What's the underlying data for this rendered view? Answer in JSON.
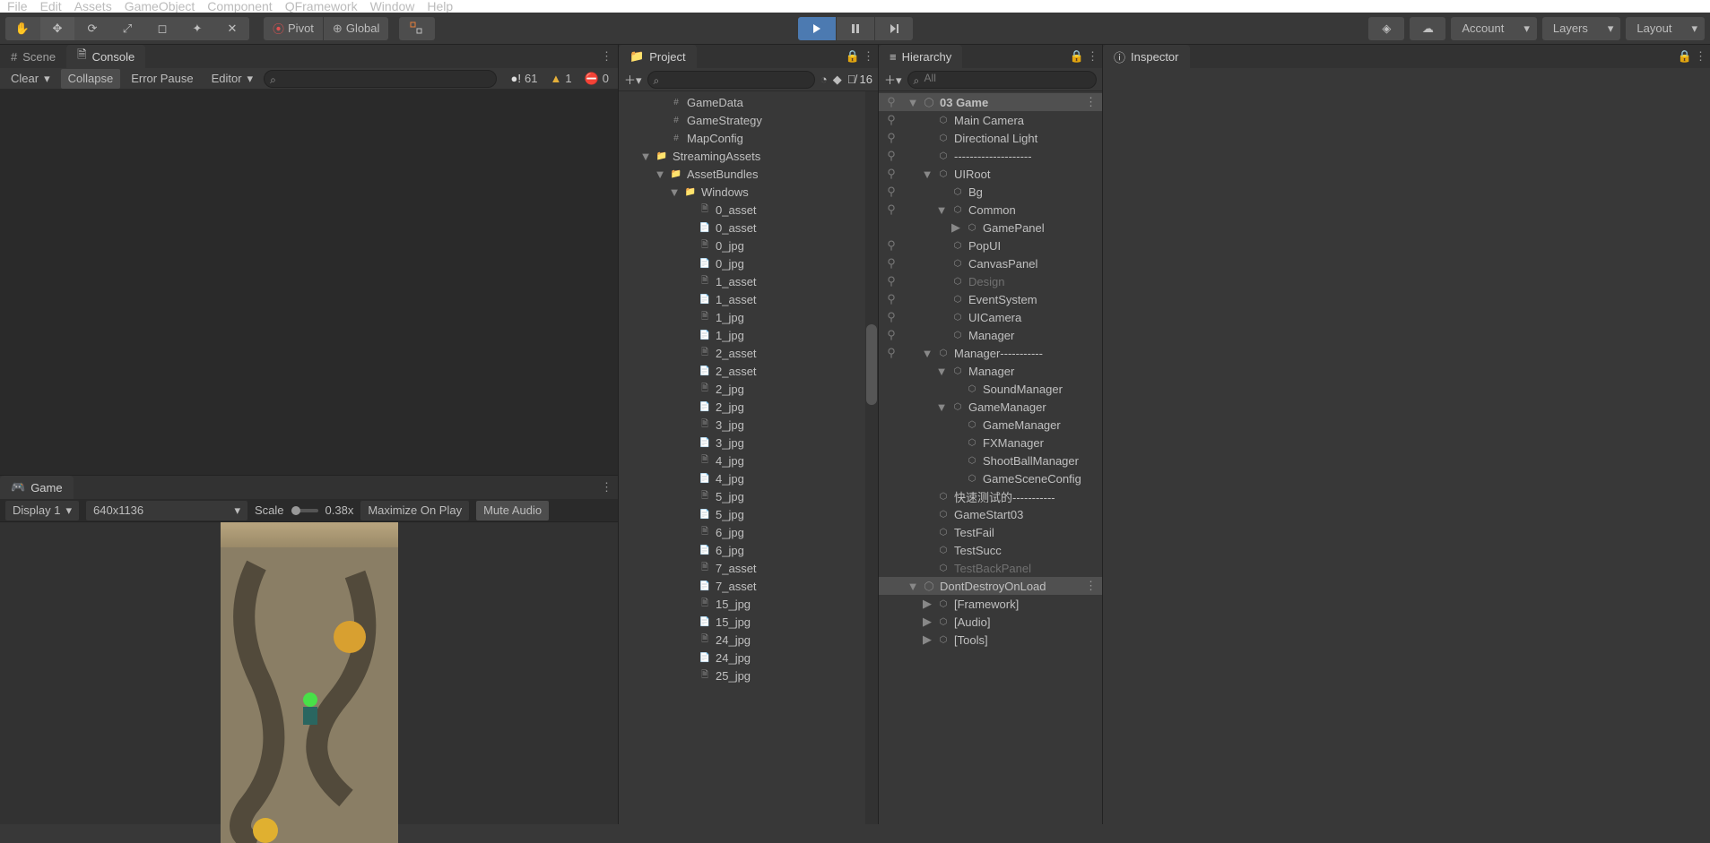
{
  "menu": [
    "File",
    "Edit",
    "Assets",
    "GameObject",
    "Component",
    "QFramework",
    "Window",
    "Help"
  ],
  "pivot": "Pivot",
  "global": "Global",
  "topbar": {
    "account": "Account",
    "layers": "Layers",
    "layout": "Layout"
  },
  "scene_tab": "Scene",
  "console_tab": "Console",
  "console": {
    "clear": "Clear",
    "collapse": "Collapse",
    "errorPause": "Error Pause",
    "editor": "Editor",
    "info": "61",
    "warn": "1",
    "error": "0"
  },
  "game_tab": "Game",
  "game_toolbar": {
    "display": "Display 1",
    "resolution": "640x1136",
    "scale_label": "Scale",
    "scale_value": "0.38x",
    "maximize": "Maximize On Play",
    "mute": "Mute Audio"
  },
  "project_tab": "Project",
  "hierarchy_tab": "Hierarchy",
  "inspector_tab": "Inspector",
  "search_placeholder": "",
  "hierarchy_search_placeholder": "All",
  "hidden_count": "16",
  "project_items": [
    {
      "indent": 2,
      "icon": "script",
      "label": "GameData"
    },
    {
      "indent": 2,
      "icon": "script",
      "label": "GameStrategy"
    },
    {
      "indent": 2,
      "icon": "script",
      "label": "MapConfig"
    },
    {
      "indent": 1,
      "icon": "folder",
      "label": "StreamingAssets",
      "fold": "▼"
    },
    {
      "indent": 2,
      "icon": "folder",
      "label": "AssetBundles",
      "fold": "▼"
    },
    {
      "indent": 3,
      "icon": "folder",
      "label": "Windows",
      "fold": "▼"
    },
    {
      "indent": 4,
      "icon": "file",
      "label": "0_asset"
    },
    {
      "indent": 4,
      "icon": "doc",
      "label": "0_asset"
    },
    {
      "indent": 4,
      "icon": "file",
      "label": "0_jpg"
    },
    {
      "indent": 4,
      "icon": "doc",
      "label": "0_jpg"
    },
    {
      "indent": 4,
      "icon": "file",
      "label": "1_asset"
    },
    {
      "indent": 4,
      "icon": "doc",
      "label": "1_asset"
    },
    {
      "indent": 4,
      "icon": "file",
      "label": "1_jpg"
    },
    {
      "indent": 4,
      "icon": "doc",
      "label": "1_jpg"
    },
    {
      "indent": 4,
      "icon": "file",
      "label": "2_asset"
    },
    {
      "indent": 4,
      "icon": "doc",
      "label": "2_asset"
    },
    {
      "indent": 4,
      "icon": "file",
      "label": "2_jpg"
    },
    {
      "indent": 4,
      "icon": "doc",
      "label": "2_jpg"
    },
    {
      "indent": 4,
      "icon": "file",
      "label": "3_jpg"
    },
    {
      "indent": 4,
      "icon": "doc",
      "label": "3_jpg"
    },
    {
      "indent": 4,
      "icon": "file",
      "label": "4_jpg"
    },
    {
      "indent": 4,
      "icon": "doc",
      "label": "4_jpg"
    },
    {
      "indent": 4,
      "icon": "file",
      "label": "5_jpg"
    },
    {
      "indent": 4,
      "icon": "doc",
      "label": "5_jpg"
    },
    {
      "indent": 4,
      "icon": "file",
      "label": "6_jpg"
    },
    {
      "indent": 4,
      "icon": "doc",
      "label": "6_jpg"
    },
    {
      "indent": 4,
      "icon": "file",
      "label": "7_asset"
    },
    {
      "indent": 4,
      "icon": "doc",
      "label": "7_asset"
    },
    {
      "indent": 4,
      "icon": "file",
      "label": "15_jpg"
    },
    {
      "indent": 4,
      "icon": "doc",
      "label": "15_jpg"
    },
    {
      "indent": 4,
      "icon": "file",
      "label": "24_jpg"
    },
    {
      "indent": 4,
      "icon": "doc",
      "label": "24_jpg"
    },
    {
      "indent": 4,
      "icon": "file",
      "label": "25_jpg"
    }
  ],
  "hierarchy_items": [
    {
      "indent": 0,
      "icon": "unity",
      "label": "03 Game",
      "fold": "▼",
      "selected": true,
      "bold": true,
      "tog": true,
      "menu": true
    },
    {
      "indent": 1,
      "icon": "box",
      "label": "Main Camera",
      "tog": true
    },
    {
      "indent": 1,
      "icon": "box",
      "label": "Directional Light",
      "tog": true
    },
    {
      "indent": 1,
      "icon": "dimbox",
      "label": "--------------------",
      "tog": true
    },
    {
      "indent": 1,
      "icon": "box",
      "label": "UIRoot",
      "fold": "▼",
      "tog": true
    },
    {
      "indent": 2,
      "icon": "box",
      "label": "Bg",
      "tog": true
    },
    {
      "indent": 2,
      "icon": "box",
      "label": "Common",
      "fold": "▼",
      "tog": true
    },
    {
      "indent": 3,
      "icon": "box",
      "label": "GamePanel",
      "fold": "▶"
    },
    {
      "indent": 2,
      "icon": "box",
      "label": "PopUI",
      "tog": true
    },
    {
      "indent": 2,
      "icon": "box",
      "label": "CanvasPanel",
      "tog": true
    },
    {
      "indent": 2,
      "icon": "dimbox",
      "label": "Design",
      "dim": true,
      "tog": true
    },
    {
      "indent": 2,
      "icon": "box",
      "label": "EventSystem",
      "tog": true
    },
    {
      "indent": 2,
      "icon": "box",
      "label": "UICamera",
      "tog": true
    },
    {
      "indent": 2,
      "icon": "box",
      "label": "Manager",
      "tog": true
    },
    {
      "indent": 1,
      "icon": "box",
      "label": "Manager-----------",
      "fold": "▼",
      "tog": true
    },
    {
      "indent": 2,
      "icon": "box",
      "label": "Manager",
      "fold": "▼"
    },
    {
      "indent": 3,
      "icon": "box",
      "label": "SoundManager"
    },
    {
      "indent": 2,
      "icon": "box",
      "label": "GameManager",
      "fold": "▼"
    },
    {
      "indent": 3,
      "icon": "box",
      "label": "GameManager"
    },
    {
      "indent": 3,
      "icon": "box",
      "label": "FXManager"
    },
    {
      "indent": 3,
      "icon": "box",
      "label": "ShootBallManager"
    },
    {
      "indent": 3,
      "icon": "box",
      "label": "GameSceneConfig"
    },
    {
      "indent": 1,
      "icon": "box",
      "label": "快速测试的-----------"
    },
    {
      "indent": 1,
      "icon": "box",
      "label": "GameStart03"
    },
    {
      "indent": 1,
      "icon": "box",
      "label": "TestFail"
    },
    {
      "indent": 1,
      "icon": "box",
      "label": "TestSucc"
    },
    {
      "indent": 1,
      "icon": "dimbox",
      "label": "TestBackPanel",
      "dim": true
    },
    {
      "indent": 0,
      "icon": "unity",
      "label": "DontDestroyOnLoad",
      "fold": "▼",
      "selected": true,
      "menu": true
    },
    {
      "indent": 1,
      "icon": "box",
      "label": "[Framework]",
      "fold": "▶"
    },
    {
      "indent": 1,
      "icon": "box",
      "label": "[Audio]",
      "fold": "▶"
    },
    {
      "indent": 1,
      "icon": "box",
      "label": "[Tools]",
      "fold": "▶"
    }
  ]
}
